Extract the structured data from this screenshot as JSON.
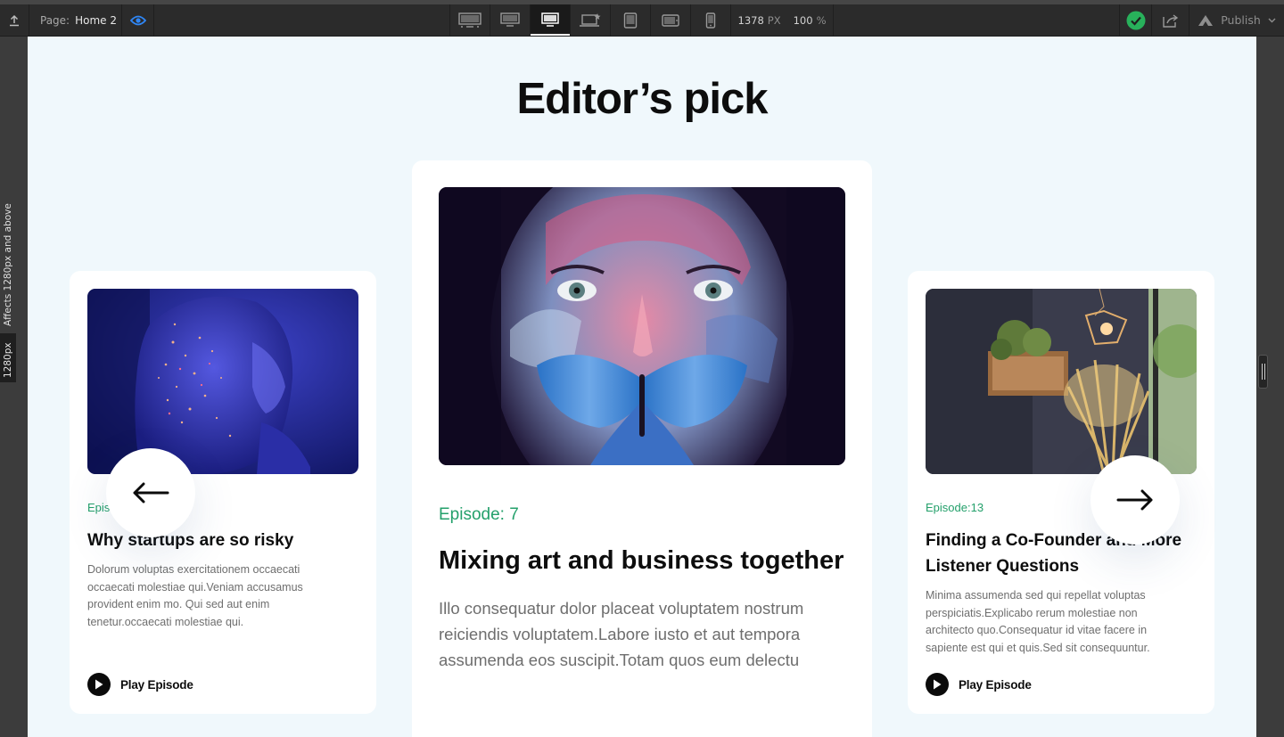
{
  "toolbar": {
    "page_label": "Page:",
    "page_name": "Home 2",
    "width_value": "1378",
    "width_unit": "PX",
    "zoom_value": "100",
    "zoom_unit": "%",
    "publish_label": "Publish",
    "breakpoints": [
      "desktop-1920-icon",
      "desktop-1440-icon",
      "desktop-1280-icon",
      "laptop-base-icon",
      "tablet-icon",
      "tablet-landscape-icon",
      "mobile-icon"
    ],
    "active_breakpoint": "desktop-1280-icon",
    "colors": {
      "bar": "#2b2b2b",
      "eye": "#2f86f5",
      "check": "#28b15b"
    }
  },
  "side": {
    "affects_text": "Affects 1280px and above",
    "breakpoint_tag": "1280px"
  },
  "canvas": {
    "section_title": "Editor’s pick",
    "accent_color": "#24a06b",
    "cards": [
      {
        "episode": "Episode: 6",
        "title": "Why startups are so risky",
        "description": "Dolorum voluptas exercitationem occaecati occaecati molestiae qui.Veniam accusamus provident enim mo. Qui sed aut enim tenetur.occaecati molestiae qui.",
        "play_label": "Play Episode"
      },
      {
        "episode": "Episode: 7",
        "title": "Mixing art and business together",
        "description": "Illo consequatur dolor placeat voluptatem nostrum reiciendis voluptatem.Labore iusto et aut tempora assumenda eos suscipit.Totam quos eum delectu"
      },
      {
        "episode": "Episode:13",
        "title": "Finding a Co-Founder and More Listener Questions",
        "description": "Minima assumenda sed qui repellat voluptas perspiciatis.Explicabo rerum molestiae non architecto quo.Consequatur id vitae facere in sapiente est qui et quis.Sed sit consequuntur.",
        "play_label": "Play Episode"
      }
    ]
  }
}
